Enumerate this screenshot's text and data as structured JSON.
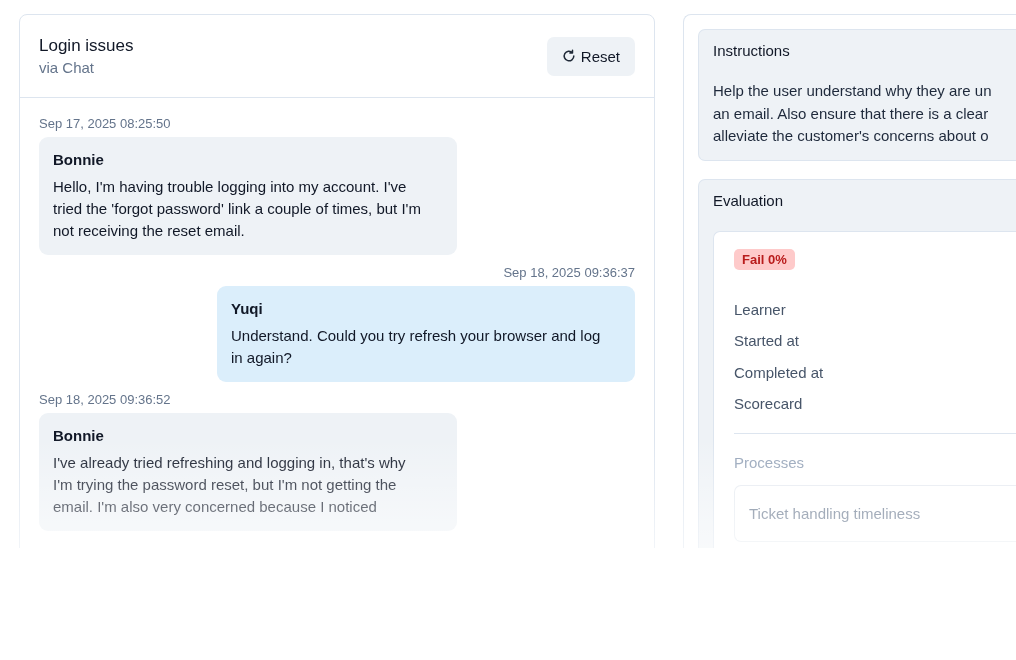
{
  "conversation": {
    "title": "Login issues",
    "channel": "via Chat",
    "reset_button": "Reset",
    "messages": [
      {
        "kind": "customer",
        "time": "Sep 17, 2025 08:25:50",
        "author": "Bonnie",
        "text": "Hello, I'm having trouble logging into my account. I've tried the 'forgot password' link a couple of times, but I'm not receiving the reset email."
      },
      {
        "kind": "agent",
        "time": "Sep 18, 2025 09:36:37",
        "author": "Yuqi",
        "text": "Understand. Could you try refresh your browser and log in again?"
      },
      {
        "kind": "customer",
        "time": "Sep 18, 2025 09:36:52",
        "author": "Bonnie",
        "text": "I've already tried refreshing and logging in, that's why I'm trying the password reset, but I'm not getting the email. I'm also very concerned because I noticed"
      }
    ]
  },
  "instructions": {
    "title": "Instructions",
    "lines": [
      "Help the user understand why they are un",
      "an email. Also ensure that there is a clear",
      "alleviate the customer's concerns about o"
    ]
  },
  "evaluation": {
    "title": "Evaluation",
    "result": "Fail 0%",
    "fields": [
      "Learner",
      "Started at",
      "Completed at",
      "Scorecard"
    ],
    "processes_title": "Processes",
    "processes": [
      "Ticket handling timeliness"
    ]
  }
}
